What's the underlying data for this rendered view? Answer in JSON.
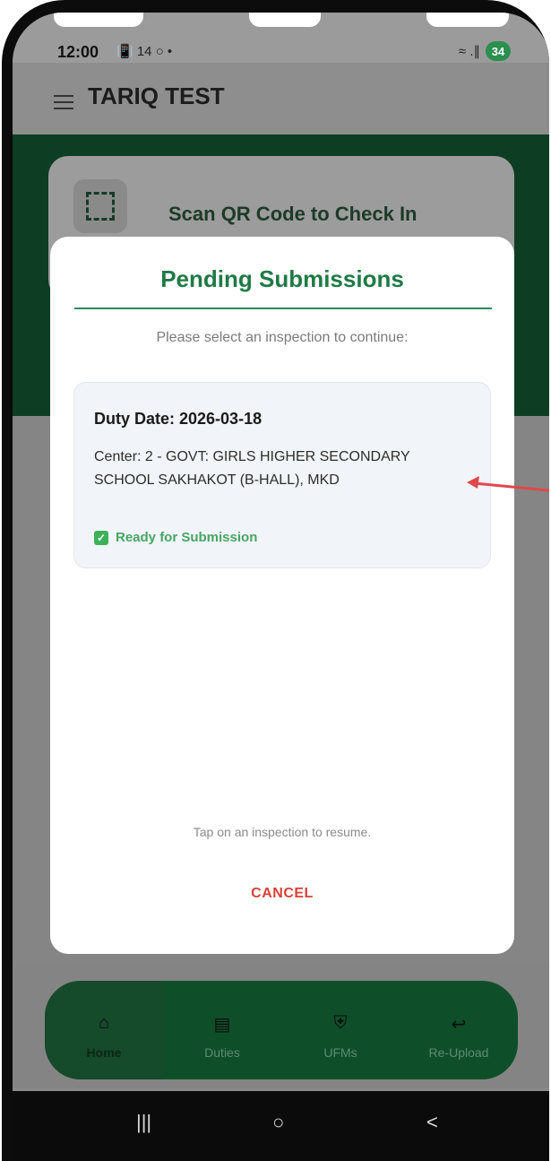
{
  "status_bar": {
    "time": "12:00",
    "left_icons": "📳 14 ○ •",
    "right_icons": "≈ .∥",
    "battery_level": "34"
  },
  "app_bar": {
    "title": "TARIQ TEST"
  },
  "hero": {
    "scan_label": "Scan QR Code to Check In"
  },
  "dialog": {
    "title": "Pending Submissions",
    "subtitle": "Please select an inspection to continue:",
    "items": [
      {
        "duty_date": "Duty Date: 2026-03-18",
        "center": "Center: 2 - GOVT: GIRLS HIGHER SECONDARY SCHOOL SAKHAKOT (B-HALL), MKD",
        "status": "Ready for Submission"
      }
    ],
    "hint": "Tap on an inspection to resume.",
    "cancel_label": "CANCEL"
  },
  "bottom_nav": {
    "items": [
      {
        "label": "Home",
        "icon": "home-icon",
        "active": true
      },
      {
        "label": "Duties",
        "icon": "clipboard-icon",
        "active": false
      },
      {
        "label": "UFMs",
        "icon": "shield-x-icon",
        "active": false
      },
      {
        "label": "Re-Upload",
        "icon": "reply-icon",
        "active": false
      }
    ]
  },
  "system_nav": {
    "recents": "|||",
    "home": "○",
    "back": "<"
  },
  "colors": {
    "primary_green": "#1f7a45",
    "nav_green": "#0e4f2a",
    "cancel_red": "#d9403a",
    "ready_green": "#47a566",
    "annotation_red": "#e0484a"
  }
}
